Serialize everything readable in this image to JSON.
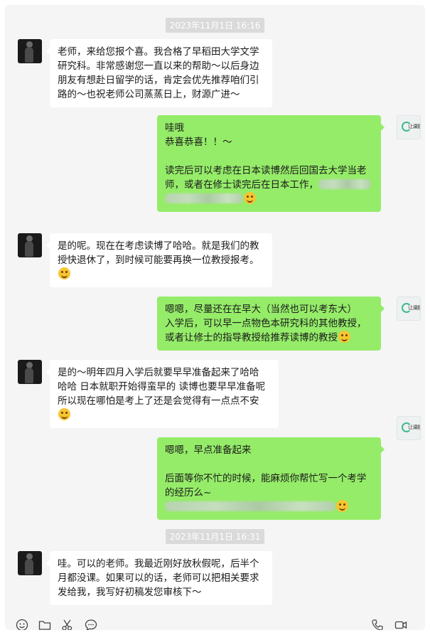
{
  "timestamps": [
    "2023年11月1日 16:16",
    "2023年11月1日 16:31"
  ],
  "contact_avatar_text": "让课题学",
  "messages": [
    {
      "side": "left",
      "lines": [
        "老师，来给您报个喜。我合格了早稻田大学文学",
        "研究科。非常感谢您一直以来的帮助～以后身边",
        "朋友有想赴日留学的话，肯定会优先推荐咱们引",
        "路的～也祝老师公司蒸蒸日上，财源广进～"
      ]
    },
    {
      "side": "right",
      "lines": [
        "哇哦",
        "恭喜恭喜！！～",
        "",
        "读完后可以考虑在日本读博然后回国去大学当老",
        "师，或者在修士读完后在日本工作，"
      ],
      "emoji": "thinking-face-emoji"
    },
    {
      "side": "left",
      "lines": [
        "是的呢。现在在考虑读博了哈哈。就是我们的教",
        "授快退休了，到时候可能要再换一位教授报考。"
      ],
      "emoji": "smiling-face-emoji"
    },
    {
      "side": "right",
      "lines": [
        "嗯嗯，尽量还在在早大（当然也可以考东大）",
        "入学后，可以早一点物色本研究科的其他教授，",
        "或者让修士的指导教授给推荐读博的教授"
      ],
      "emoji": "thinking-face-emoji"
    },
    {
      "side": "left",
      "lines": [
        "是的～明年四月入学后就要早早准备起来了哈哈",
        "哈哈 日本就职开始得蛮早的 读博也要早早准备呢",
        "所以现在哪怕是考上了还是会觉得有一点点不安"
      ],
      "emoji": "tears-of-joy-emoji"
    },
    {
      "side": "right",
      "lines": [
        "嗯嗯，早点准备起来",
        "",
        "后面等你不忙的时候，能麻烦你帮忙写一个考学",
        "的经历么~"
      ],
      "emoji": "smiling-face-emoji"
    },
    {
      "side": "left",
      "lines": [
        "哇。可以的老师。我最近刚好放秋假呢，后半个",
        "月都没课。如果可以的话，老师可以把相关要求",
        "发给我，我写好初稿发您审核下～"
      ]
    }
  ],
  "toolbar": [
    "emoji-icon",
    "folder-icon",
    "scissors-icon",
    "chat-bubble-icon",
    "phone-icon",
    "video-icon"
  ]
}
